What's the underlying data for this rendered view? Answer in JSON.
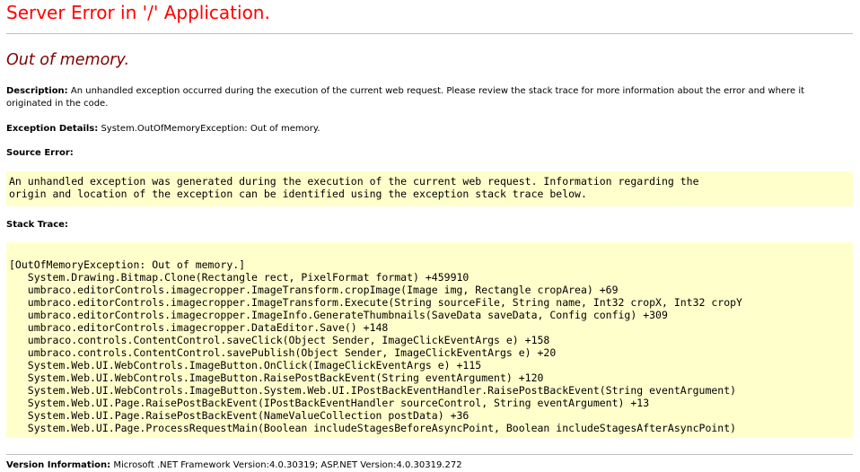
{
  "header": {
    "title": "Server Error in '/' Application.",
    "subtitle": "Out of memory."
  },
  "description": {
    "label": "Description:",
    "text": "An unhandled exception occurred during the execution of the current web request. Please review the stack trace for more information about the error and where it originated in the code."
  },
  "exception_details": {
    "label": "Exception Details:",
    "text": "System.OutOfMemoryException: Out of memory."
  },
  "source_error": {
    "label": "Source Error:",
    "lines": [
      "An unhandled exception was generated during the execution of the current web request. Information regarding the",
      "origin and location of the exception can be identified using the exception stack trace below."
    ]
  },
  "stack_trace": {
    "label": "Stack Trace:",
    "frames": [
      "[OutOfMemoryException: Out of memory.]",
      "   System.Drawing.Bitmap.Clone(Rectangle rect, PixelFormat format) +459910",
      "   umbraco.editorControls.imagecropper.ImageTransform.cropImage(Image img, Rectangle cropArea) +69",
      "   umbraco.editorControls.imagecropper.ImageTransform.Execute(String sourceFile, String name, Int32 cropX, Int32 cropY",
      "   umbraco.editorControls.imagecropper.ImageInfo.GenerateThumbnails(SaveData saveData, Config config) +309",
      "   umbraco.editorControls.imagecropper.DataEditor.Save() +148",
      "   umbraco.controls.ContentControl.saveClick(Object Sender, ImageClickEventArgs e) +158",
      "   umbraco.controls.ContentControl.savePublish(Object Sender, ImageClickEventArgs e) +20",
      "   System.Web.UI.WebControls.ImageButton.OnClick(ImageClickEventArgs e) +115",
      "   System.Web.UI.WebControls.ImageButton.RaisePostBackEvent(String eventArgument) +120",
      "   System.Web.UI.WebControls.ImageButton.System.Web.UI.IPostBackEventHandler.RaisePostBackEvent(String eventArgument)",
      "   System.Web.UI.Page.RaisePostBackEvent(IPostBackEventHandler sourceControl, String eventArgument) +13",
      "   System.Web.UI.Page.RaisePostBackEvent(NameValueCollection postData) +36",
      "   System.Web.UI.Page.ProcessRequestMain(Boolean includeStagesBeforeAsyncPoint, Boolean includeStagesAfterAsyncPoint)"
    ]
  },
  "version_information": {
    "label": "Version Information:",
    "text": "Microsoft .NET Framework Version:4.0.30319; ASP.NET Version:4.0.30319.272"
  }
}
